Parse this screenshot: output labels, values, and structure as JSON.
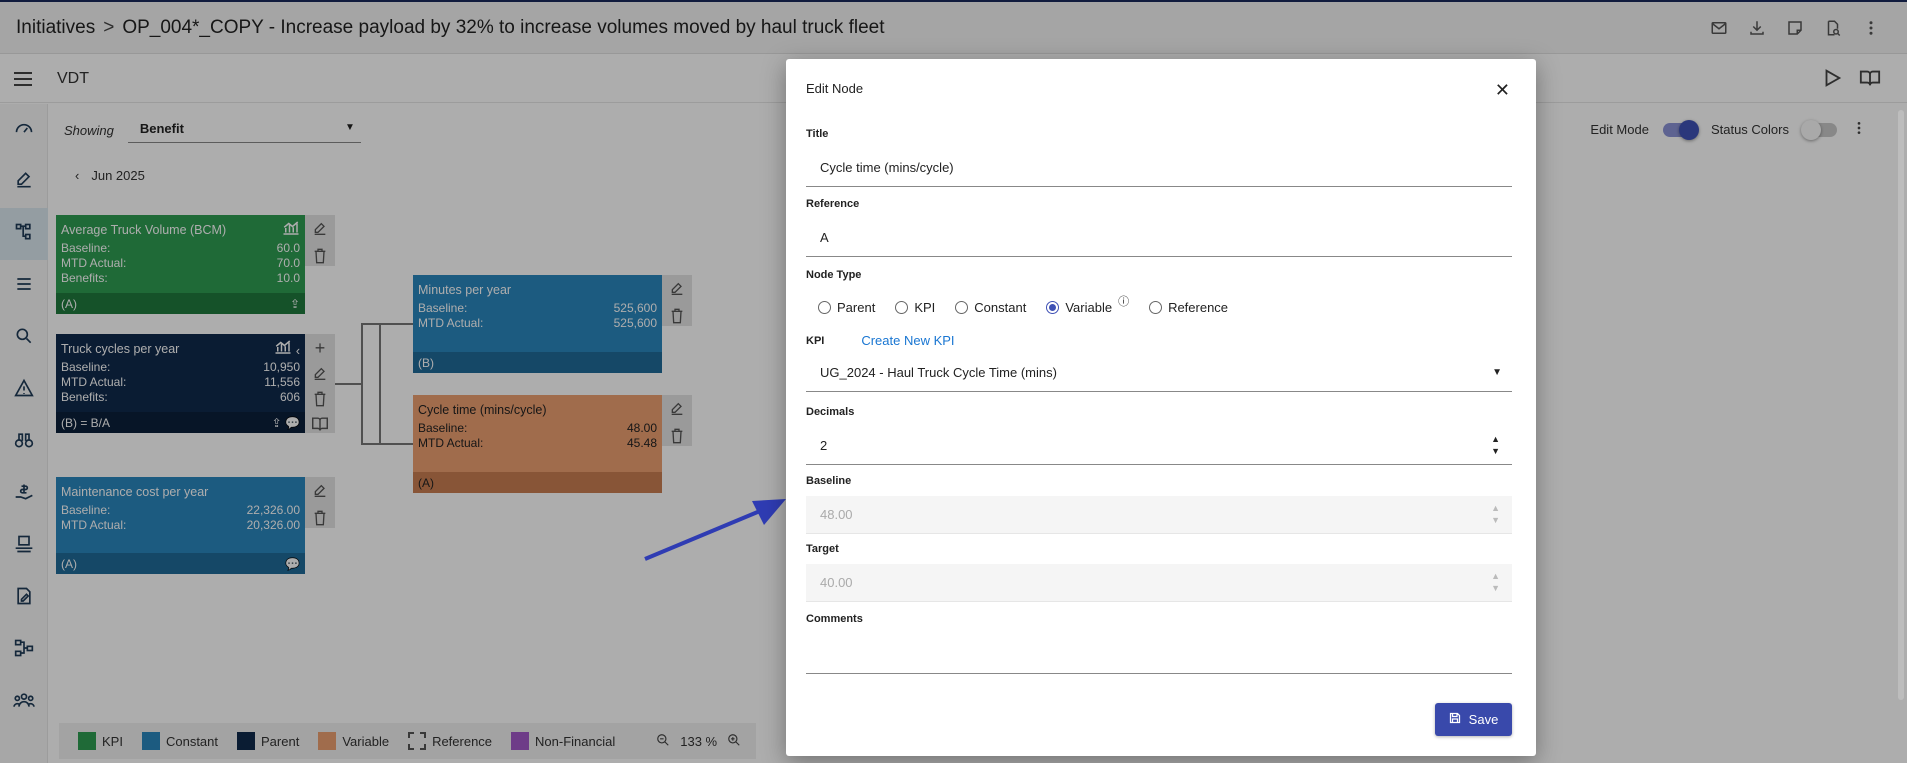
{
  "header": {
    "breadcrumb_root": "Initiatives",
    "title": "OP_004*_COPY - Increase payload by 32% to increase volumes moved by haul truck fleet"
  },
  "subbar": {
    "title": "VDT"
  },
  "canvas": {
    "showing_label": "Showing",
    "showing_value": "Benefit",
    "period": "Jun 2025",
    "edit_mode_label": "Edit Mode",
    "status_colors_label": "Status Colors"
  },
  "nodes": {
    "avg_truck": {
      "title": "Average Truck Volume (BCM)",
      "baseline_label": "Baseline:",
      "baseline": "60.0",
      "mtd_label": "MTD Actual:",
      "mtd": "70.0",
      "benefits_label": "Benefits:",
      "benefits": "10.0",
      "foot": "(A)"
    },
    "truck_cycles": {
      "title": "Truck cycles per year",
      "baseline_label": "Baseline:",
      "baseline": "10,950",
      "mtd_label": "MTD Actual:",
      "mtd": "11,556",
      "benefits_label": "Benefits:",
      "benefits": "606",
      "foot": "(B) = B/A"
    },
    "maintenance": {
      "title": "Maintenance cost per year",
      "baseline_label": "Baseline:",
      "baseline": "22,326.00",
      "mtd_label": "MTD Actual:",
      "mtd": "20,326.00",
      "foot": "(A)"
    },
    "minutes": {
      "title": "Minutes per year",
      "baseline_label": "Baseline:",
      "baseline": "525,600",
      "mtd_label": "MTD Actual:",
      "mtd": "525,600",
      "foot": "(B)"
    },
    "cycle_time": {
      "title": "Cycle time (mins/cycle)",
      "baseline_label": "Baseline:",
      "baseline": "48.00",
      "mtd_label": "MTD Actual:",
      "mtd": "45.48",
      "foot": "(A)"
    }
  },
  "legend": {
    "items": [
      {
        "label": "KPI",
        "color": "#2e9c52"
      },
      {
        "label": "Constant",
        "color": "#2a86bd"
      },
      {
        "label": "Parent",
        "color": "#102a4c"
      },
      {
        "label": "Variable",
        "color": "#ec9f71"
      },
      {
        "label": "Reference",
        "color": "dashed"
      },
      {
        "label": "Non-Financial",
        "color": "#a259c9"
      }
    ],
    "zoom": "133 %"
  },
  "modal": {
    "title": "Edit Node",
    "title_label": "Title",
    "title_value": "Cycle time (mins/cycle)",
    "reference_label": "Reference",
    "reference_value": "A",
    "node_type_label": "Node Type",
    "node_types": [
      "Parent",
      "KPI",
      "Constant",
      "Variable",
      "Reference"
    ],
    "node_type_selected": "Variable",
    "kpi_label": "KPI",
    "create_kpi": "Create New KPI",
    "kpi_value": "UG_2024 - Haul Truck Cycle Time (mins)",
    "decimals_label": "Decimals",
    "decimals_value": "2",
    "baseline_label": "Baseline",
    "baseline_value": "48.00",
    "target_label": "Target",
    "target_value": "40.00",
    "comments_label": "Comments",
    "comments_value": "",
    "save_label": "Save"
  }
}
